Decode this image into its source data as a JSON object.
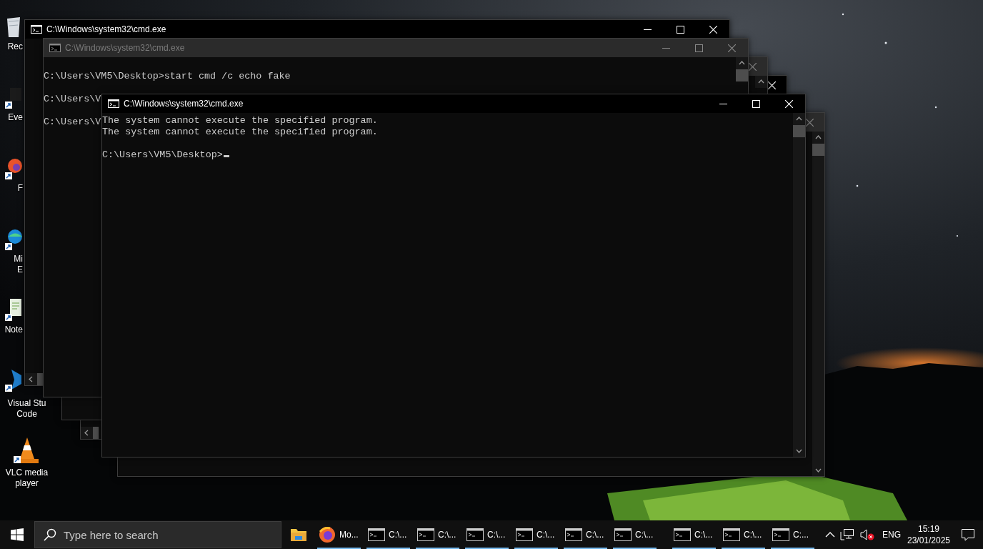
{
  "desktop_icons": [
    {
      "kind": "recycle",
      "label": [
        "Rec"
      ]
    },
    {
      "kind": "app",
      "label": [
        "Eve"
      ]
    },
    {
      "kind": "firefox",
      "label": [
        "F"
      ]
    },
    {
      "kind": "edge",
      "label": [
        "Mi",
        "E"
      ]
    },
    {
      "kind": "notepad",
      "label": [
        "Note"
      ]
    },
    {
      "kind": "vscode",
      "label": [
        "Visual Stu",
        "Code"
      ]
    },
    {
      "kind": "vlc",
      "label": [
        "VLC media",
        "player"
      ]
    }
  ],
  "windows": [
    {
      "title": "C:\\Windows\\system32\\cmd.exe",
      "active": true
    },
    {
      "title": "C:\\Windows\\system32\\cmd.exe",
      "active": false,
      "blocks": [
        [
          "C:\\Users\\VM5\\Desktop>start cmd /c echo fake"
        ],
        [
          "C:\\Users\\V"
        ],
        [
          "C:\\Users\\V"
        ]
      ]
    },
    {
      "active": false
    },
    {
      "active": true
    },
    {
      "title": "C:\\Windows\\system32\\cmd.exe",
      "active": true,
      "blocks": [
        [
          "The system cannot execute the specified program.",
          "The system cannot execute the specified program."
        ],
        [
          "C:\\Users\\VM5\\Desktop>"
        ]
      ],
      "cursor": true
    },
    {
      "active": false
    }
  ],
  "taskbar": {
    "search": {
      "placeholder": "Type here to search"
    },
    "apps": [
      {
        "kind": "folder",
        "running": false
      },
      {
        "kind": "browser",
        "label": "Mo...",
        "running": true
      },
      {
        "kind": "console",
        "label": "C:\\...",
        "running": true
      },
      {
        "kind": "console",
        "label": "C:\\...",
        "running": true
      },
      {
        "kind": "console",
        "label": "C:\\...",
        "running": true
      },
      {
        "kind": "console",
        "label": "C:\\...",
        "running": true
      },
      {
        "kind": "console",
        "label": "C:\\...",
        "running": true
      },
      {
        "kind": "console",
        "label": "C:\\...",
        "running": true
      },
      {
        "kind": "console",
        "label": "C:\\...",
        "running": true
      },
      {
        "kind": "console",
        "label": "C:\\...",
        "running": true
      },
      {
        "kind": "console",
        "label": "C:...",
        "running": true
      }
    ],
    "tray": {
      "language": "ENG",
      "time": "15:19",
      "date": "23/01/2025",
      "volume_muted": true
    }
  }
}
